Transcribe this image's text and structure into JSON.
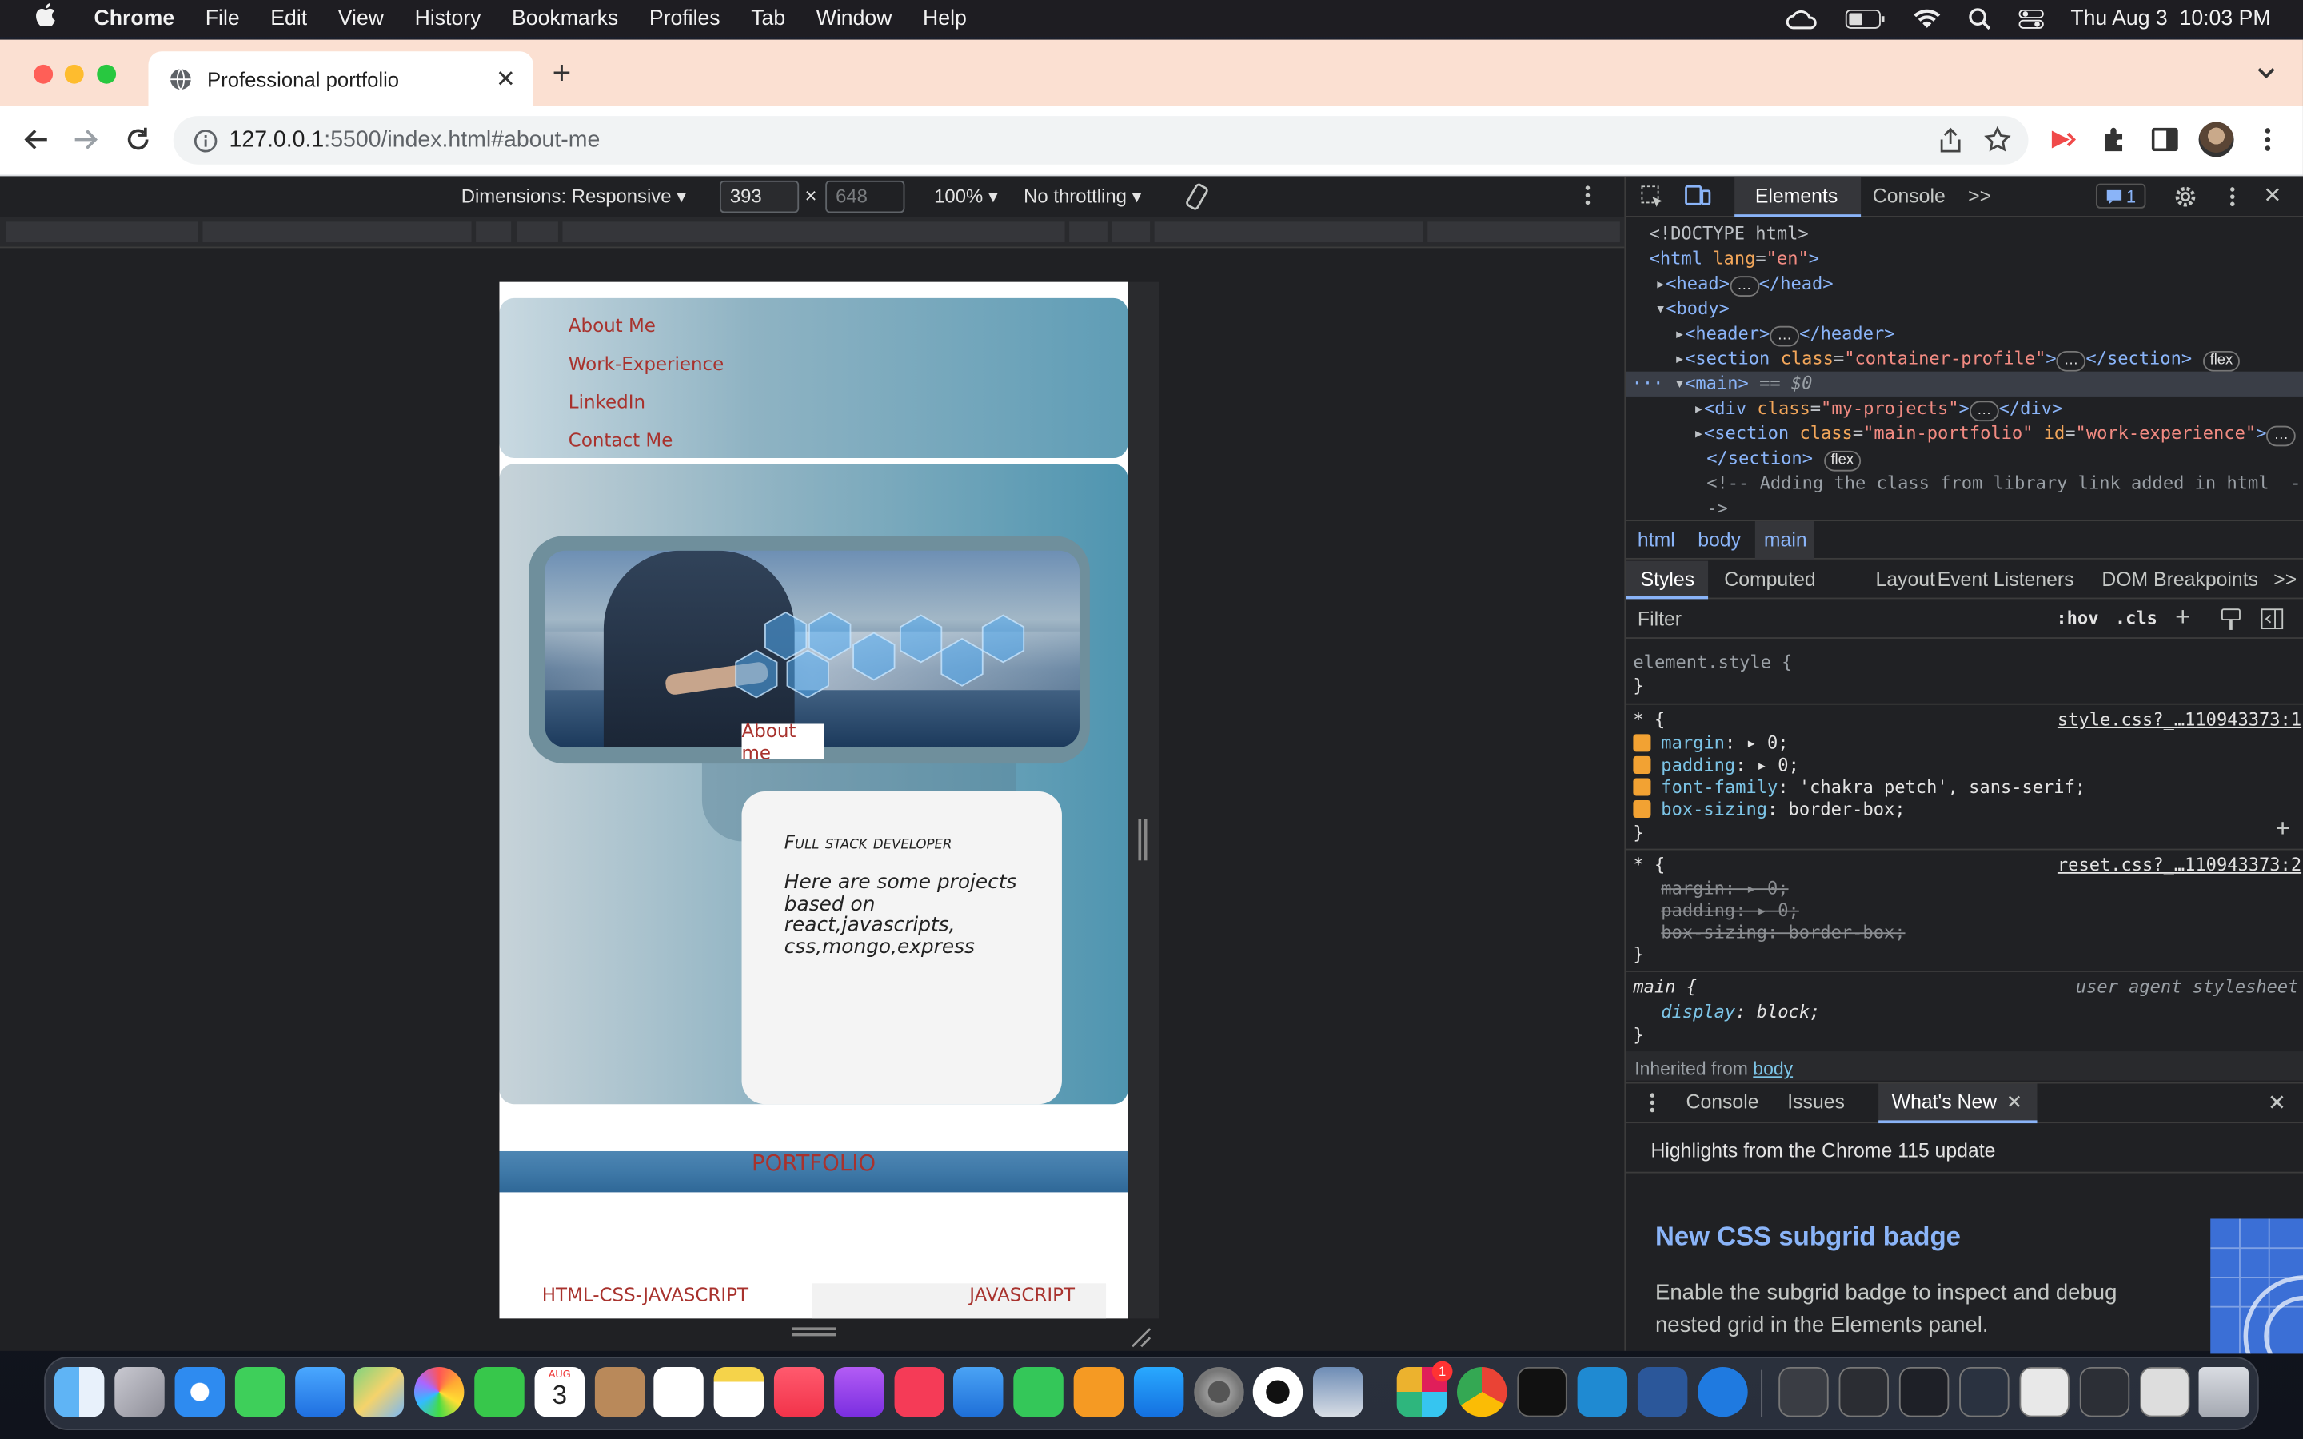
{
  "menubar": {
    "apple": "",
    "app_name": "Chrome",
    "items": [
      "File",
      "Edit",
      "View",
      "History",
      "Bookmarks",
      "Profiles",
      "Tab",
      "Window",
      "Help"
    ],
    "datetime": "Thu Aug 3  10:03 PM"
  },
  "browser": {
    "tab_title": "Professional portfolio",
    "url_host": "127.0.0.1",
    "url_rest": ":5500/index.html#about-me"
  },
  "device_toolbar": {
    "dimensions_label": "Dimensions: Responsive",
    "width": "393",
    "height_placeholder": "648",
    "times": "×",
    "zoom": "100%",
    "throttling": "No throttling"
  },
  "site": {
    "nav": [
      "About Me",
      "Work-Experience",
      "LinkedIn",
      "Contact Me"
    ],
    "about_button": "About me",
    "card_title": "Full stack developer",
    "card_text": "Here are some projects based on react,javascripts, css,mongo,express",
    "portfolio_heading": "PORTFOLIO",
    "project_left": "HTML-CSS-JAVASCRIPT",
    "project_right": "JAVASCRIPT"
  },
  "devtools": {
    "tabs": [
      "Elements",
      "Console"
    ],
    "more_tabs": ">>",
    "issues_count": "1",
    "dom": {
      "doctype": "<!DOCTYPE html>",
      "html_open": "html",
      "html_attr": "lang",
      "html_attr_val": "\"en\"",
      "head": "head",
      "body": "body",
      "header": "header",
      "section_tag": "section",
      "class_attr": "class",
      "profile_class": "\"container-profile\"",
      "flex_badge": "flex",
      "main": "main",
      "main_ref": "== $0",
      "div_tag": "div",
      "projects_class": "\"my-projects\"",
      "portfolio_class": "\"main-portfolio\"",
      "id_attr": "id",
      "work_id": "\"work-experience\"",
      "section_close": "section",
      "comment_line1": "<!-- Adding the class from library link added in html  -",
      "comment_line2": "->",
      "ellipsis": "…"
    },
    "breadcrumbs": [
      "html",
      "body",
      "main"
    ],
    "styles_tabs": [
      "Styles",
      "Computed",
      "Layout",
      "Event Listeners",
      "DOM Breakpoints"
    ],
    "filter_placeholder": "Filter",
    "hov": ":hov",
    "cls": ".cls",
    "rules": {
      "element_style": "element.style {",
      "close": "}",
      "star": "* {",
      "style_source": "style.css?_…110943373:1",
      "reset_source": "reset.css?_…110943373:2",
      "margin_prop": "margin",
      "margin_val": "0;",
      "padding_prop": "padding",
      "padding_val": "0;",
      "font_prop": "font-family",
      "font_val": "'chakra petch', sans-serif;",
      "box_prop": "box-sizing",
      "box_val": "border-box;",
      "reset_margin": "margin: ▸ 0;",
      "reset_padding": "padding: ▸ 0;",
      "reset_box": "box-sizing: border-box;",
      "main_sel": "main {",
      "ua": "user agent stylesheet",
      "display_prop": "display",
      "display_val": "block;",
      "inherited_label": "Inherited from",
      "inherited_el": "body"
    },
    "drawer": {
      "tabs": [
        "Console",
        "Issues",
        "What's New"
      ],
      "highlight": "Highlights from the Chrome 115 update",
      "news_title": "New CSS subgrid badge",
      "news_text": "Enable the subgrid badge to inspect and debug nested grid in the Elements panel."
    }
  },
  "dock": {
    "calendar_month": "AUG",
    "calendar_day": "3",
    "slack_badge": "1"
  }
}
